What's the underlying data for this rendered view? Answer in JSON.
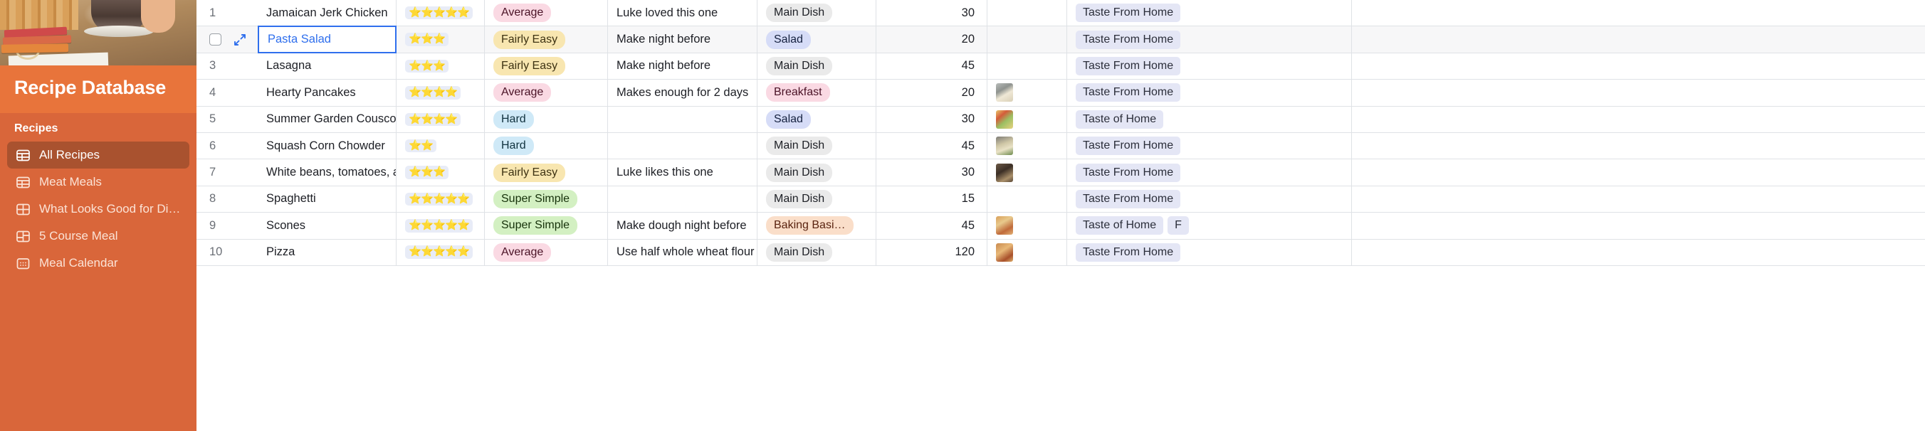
{
  "sidebar": {
    "brand_title": "Recipe Database",
    "section_label": "Recipes",
    "items": [
      {
        "label": "All Recipes",
        "icon": "grid-table-icon",
        "active": true
      },
      {
        "label": "Meat Meals",
        "icon": "grid-table-icon",
        "active": false
      },
      {
        "label": "What Looks Good for Din…",
        "icon": "gallery-grid-icon",
        "active": false
      },
      {
        "label": "5 Course Meal",
        "icon": "kanban-icon",
        "active": false
      },
      {
        "label": "Meal Calendar",
        "icon": "calendar-icon",
        "active": false
      }
    ]
  },
  "colors": {
    "brand_orange": "#E8743B",
    "sidebar_orange": "#D9663A",
    "active_nav": "#A9522F",
    "selection_blue": "#2f6fed",
    "grid_border": "#dfe2e6"
  },
  "grid": {
    "selected_row_index": 1,
    "selected_cell_column": "name",
    "rows": [
      {
        "num": "1",
        "name": "Jamaican Jerk Chicken",
        "name_link": false,
        "stars": "⭐⭐⭐⭐⭐",
        "star_count": 5,
        "difficulty": "Average",
        "difficulty_style": "p-pink",
        "notes": "Luke loved this one",
        "category": "Main Dish",
        "category_style": "p-grey",
        "time": "30",
        "photo": "",
        "photo_style": "",
        "source": "Taste From Home",
        "source2": ""
      },
      {
        "num": "2",
        "name": "Pasta Salad",
        "name_link": true,
        "stars": "⭐⭐⭐",
        "star_count": 3,
        "difficulty": "Fairly Easy",
        "difficulty_style": "p-yellow",
        "notes": "Make night before",
        "category": "Salad",
        "category_style": "p-lav",
        "time": "20",
        "photo": "",
        "photo_style": "",
        "source": "Taste From Home",
        "source2": ""
      },
      {
        "num": "3",
        "name": "Lasagna",
        "name_link": false,
        "stars": "⭐⭐⭐",
        "star_count": 3,
        "difficulty": "Fairly Easy",
        "difficulty_style": "p-yellow",
        "notes": "Make night before",
        "category": "Main Dish",
        "category_style": "p-grey",
        "time": "45",
        "photo": "",
        "photo_style": "",
        "source": "Taste From Home",
        "source2": ""
      },
      {
        "num": "4",
        "name": "Hearty Pancakes",
        "name_link": false,
        "stars": "⭐⭐⭐⭐",
        "star_count": 4,
        "difficulty": "Average",
        "difficulty_style": "p-pink",
        "notes": "Makes enough for 2 days",
        "category": "Breakfast",
        "category_style": "p-pink",
        "time": "20",
        "photo": "pancake-batter-photo",
        "photo_style": "t1",
        "source": "Taste From Home",
        "source2": ""
      },
      {
        "num": "5",
        "name": "Summer Garden Couscou…",
        "name_link": false,
        "stars": "⭐⭐⭐⭐",
        "star_count": 4,
        "difficulty": "Hard",
        "difficulty_style": "p-blue",
        "notes": "",
        "category": "Salad",
        "category_style": "p-lav",
        "time": "30",
        "photo": "couscous-photo",
        "photo_style": "t2",
        "source": "Taste of Home",
        "source2": ""
      },
      {
        "num": "6",
        "name": "Squash Corn Chowder",
        "name_link": false,
        "stars": "⭐⭐",
        "star_count": 2,
        "difficulty": "Hard",
        "difficulty_style": "p-blue",
        "notes": "",
        "category": "Main Dish",
        "category_style": "p-grey",
        "time": "45",
        "photo": "chowder-photo",
        "photo_style": "t3",
        "source": "Taste From Home",
        "source2": ""
      },
      {
        "num": "7",
        "name": "White beans, tomatoes, a…",
        "name_link": false,
        "stars": "⭐⭐⭐",
        "star_count": 3,
        "difficulty": "Fairly Easy",
        "difficulty_style": "p-yellow",
        "notes": "Luke likes this one",
        "category": "Main Dish",
        "category_style": "p-grey",
        "time": "30",
        "photo": "white-beans-photo",
        "photo_style": "t4",
        "source": "Taste From Home",
        "source2": ""
      },
      {
        "num": "8",
        "name": "Spaghetti",
        "name_link": false,
        "stars": "⭐⭐⭐⭐⭐",
        "star_count": 5,
        "difficulty": "Super Simple",
        "difficulty_style": "p-green",
        "notes": "",
        "category": "Main Dish",
        "category_style": "p-grey",
        "time": "15",
        "photo": "",
        "photo_style": "",
        "source": "Taste From Home",
        "source2": ""
      },
      {
        "num": "9",
        "name": "Scones",
        "name_link": false,
        "stars": "⭐⭐⭐⭐⭐",
        "star_count": 5,
        "difficulty": "Super Simple",
        "difficulty_style": "p-green",
        "notes": "Make dough night before",
        "category": "Baking Basi…",
        "category_style": "p-peach",
        "time": "45",
        "photo": "scones-photo",
        "photo_style": "t5",
        "source": "Taste of Home",
        "source2": "F"
      },
      {
        "num": "10",
        "name": "Pizza",
        "name_link": false,
        "stars": "⭐⭐⭐⭐⭐",
        "star_count": 5,
        "difficulty": "Average",
        "difficulty_style": "p-pink",
        "notes": "Use half whole wheat flour",
        "category": "Main Dish",
        "category_style": "p-grey",
        "time": "120",
        "photo": "pizza-photo",
        "photo_style": "t6",
        "source": "Taste From Home",
        "source2": ""
      }
    ]
  }
}
